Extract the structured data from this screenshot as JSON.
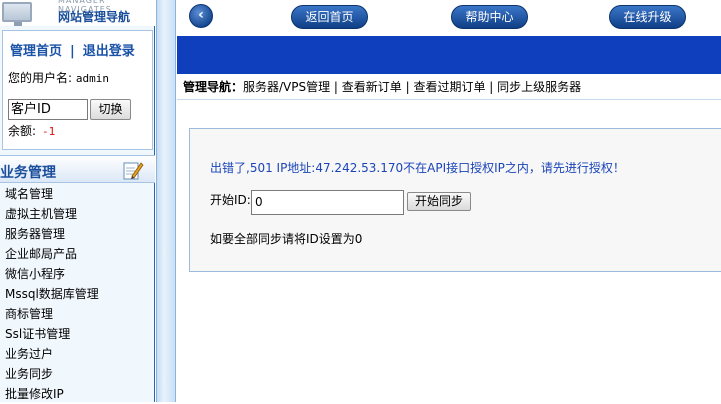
{
  "sidebar": {
    "logo_sub": "MANAGER NAVIGATES",
    "logo_title": "网站管理导航",
    "home_link": "管理首页",
    "divider": "|",
    "logout_link": "退出登录",
    "username_label": "您的用户名:",
    "username_value": "admin",
    "customer_id_value": "客户ID",
    "switch_button": "切换",
    "balance_label": "余额:",
    "balance_value": "-1",
    "section_title": "业务管理",
    "menu": [
      "域名管理",
      "虚拟主机管理",
      "服务器管理",
      "企业邮局产品",
      "微信小程序",
      "Mssql数据库管理",
      "商标管理",
      "Ssl证书管理",
      "业务过户",
      "业务同步",
      "批量修改IP"
    ]
  },
  "topnav": {
    "back_glyph": "‹",
    "buttons": [
      "返回首页",
      "帮助中心",
      "在线升级"
    ]
  },
  "breadcrumb": {
    "label": "管理导航：",
    "path": "服务器/VPS管理 | 查看新订单 | 查看过期订单 | 同步上级服务器"
  },
  "main": {
    "error_message": "出错了,501 IP地址:47.242.53.170不在API接口授权IP之内，请先进行授权！",
    "start_id_label": "开始ID:",
    "start_id_value": "0",
    "sync_button": "开始同步",
    "hint": "如要全部同步请将ID设置为0"
  },
  "colors": {
    "accent": "#0f3fbd",
    "error_text": "#1b45b8",
    "balance": "#d11111"
  }
}
